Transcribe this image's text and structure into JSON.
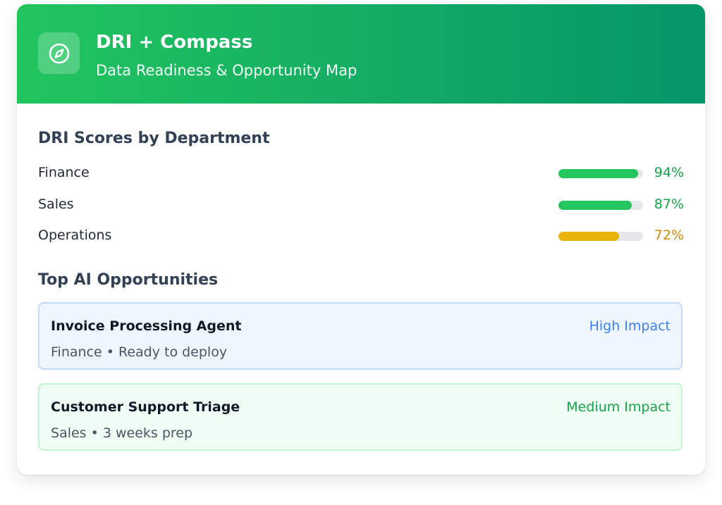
{
  "header": {
    "title": "DRI + Compass",
    "subtitle": "Data Readiness & Opportunity Map",
    "icon": "compass-icon"
  },
  "dri_section": {
    "title": "DRI Scores by Department",
    "rows": [
      {
        "name": "Finance",
        "percent_label": "94%",
        "value": 0.94,
        "bar_color": "#22c55e",
        "text_color": "#16a34a"
      },
      {
        "name": "Sales",
        "percent_label": "87%",
        "value": 0.87,
        "bar_color": "#22c55e",
        "text_color": "#16a34a"
      },
      {
        "name": "Operations",
        "percent_label": "72%",
        "value": 0.72,
        "bar_color": "#eab308",
        "text_color": "#ca8a04"
      }
    ]
  },
  "opportunities_section": {
    "title": "Top AI Opportunities",
    "items": [
      {
        "title": "Invoice Processing Agent",
        "subtitle": "Finance • Ready to deploy",
        "impact": "High Impact",
        "impact_color": "#3b82f6",
        "bg_color": "#eff6ff",
        "border_color": "#bfdbfe"
      },
      {
        "title": "Customer Support Triage",
        "subtitle": "Sales • 3 weeks prep",
        "impact": "Medium Impact",
        "impact_color": "#16a34a",
        "bg_color": "#f0fdf4",
        "border_color": "#bbf7d0"
      }
    ]
  }
}
